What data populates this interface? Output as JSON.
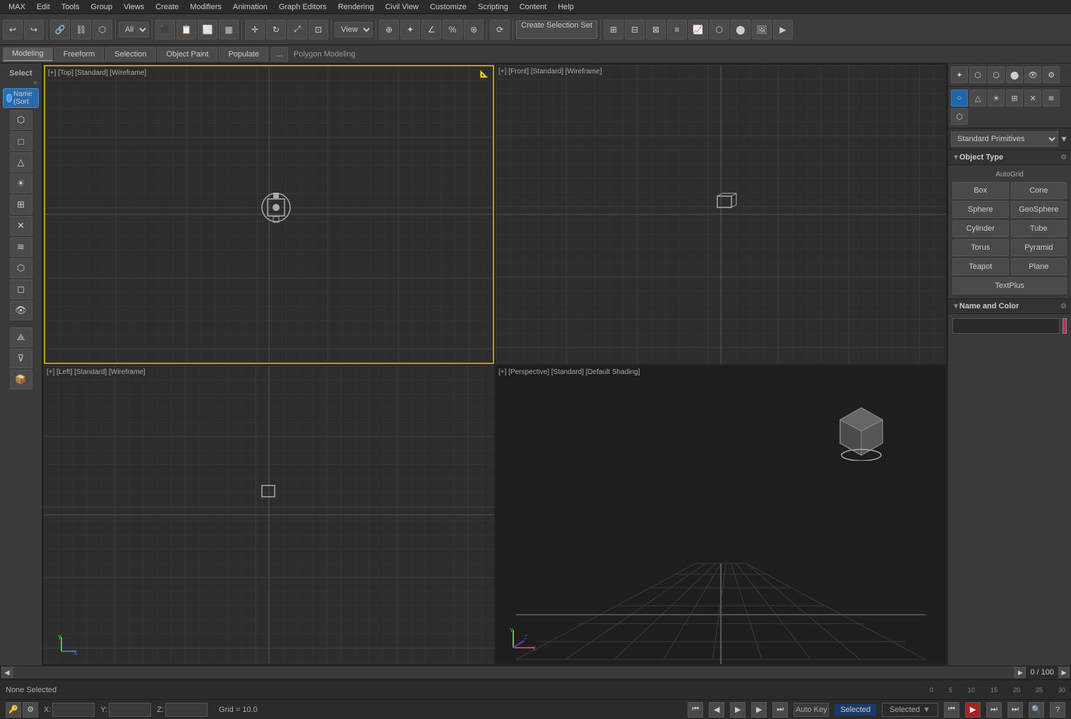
{
  "menubar": {
    "items": [
      "MAX",
      "Edit",
      "Tools",
      "Group",
      "Views",
      "Create",
      "Modifiers",
      "Animation",
      "Graph Editors",
      "Rendering",
      "Civil View",
      "Customize",
      "Scripting",
      "Content",
      "Help"
    ]
  },
  "toolbar": {
    "dropdown_label": "All",
    "create_selection_set": "Create Selection Set",
    "view_dropdown": "View"
  },
  "tabs": {
    "items": [
      "Modeling",
      "Freeform",
      "Selection",
      "Object Paint",
      "Populate"
    ],
    "active": "Modeling",
    "extra_btn": "...",
    "sub_label": "Polygon Modeling"
  },
  "left_sidebar": {
    "select_label": "Select",
    "name_sort_label": "Name (Sort"
  },
  "viewports": {
    "top": {
      "label": "[+] [Top] [Standard] [Wireframe]"
    },
    "front": {
      "label": "[+] [Front] [Standard] [Wireframe]"
    },
    "left": {
      "label": "[+] [Left] [Standard] [Wireframe]"
    },
    "perspective": {
      "label": "[+] [Perspective] [Standard] [Default Shading]"
    }
  },
  "right_panel": {
    "primitives_label": "Standard Primitives",
    "object_type_label": "Object Type",
    "autogrid_label": "AutoGrid",
    "buttons": [
      "Box",
      "Cone",
      "Sphere",
      "GeoSphere",
      "Cylinder",
      "Tube",
      "Torus",
      "Pyramid",
      "Teapot",
      "Plane",
      "TextPlus"
    ],
    "name_color_label": "Name and Color",
    "color_swatch": "#cc2266"
  },
  "status_bar": {
    "none_selected": "None Selected",
    "x_label": "X:",
    "y_label": "Y:",
    "z_label": "Z:",
    "grid_label": "Grid = 10.0",
    "auto_key": "Auto Key",
    "selected_label": "Selected",
    "timeline_range": "0 / 100"
  },
  "icons": {
    "undo": "↩",
    "redo": "↪",
    "link": "🔗",
    "unlink": "⛓",
    "select": "⬡",
    "move": "✛",
    "rotate": "↻",
    "scale": "⤢",
    "mirror": "⊞",
    "align": "⊟",
    "play": "▶",
    "prev": "⏮",
    "next": "⏭",
    "gear": "⚙",
    "chevron_right": "▶",
    "chevron_down": "▼",
    "plus": "+",
    "minus": "–",
    "collapse": "–",
    "expand": "+"
  }
}
